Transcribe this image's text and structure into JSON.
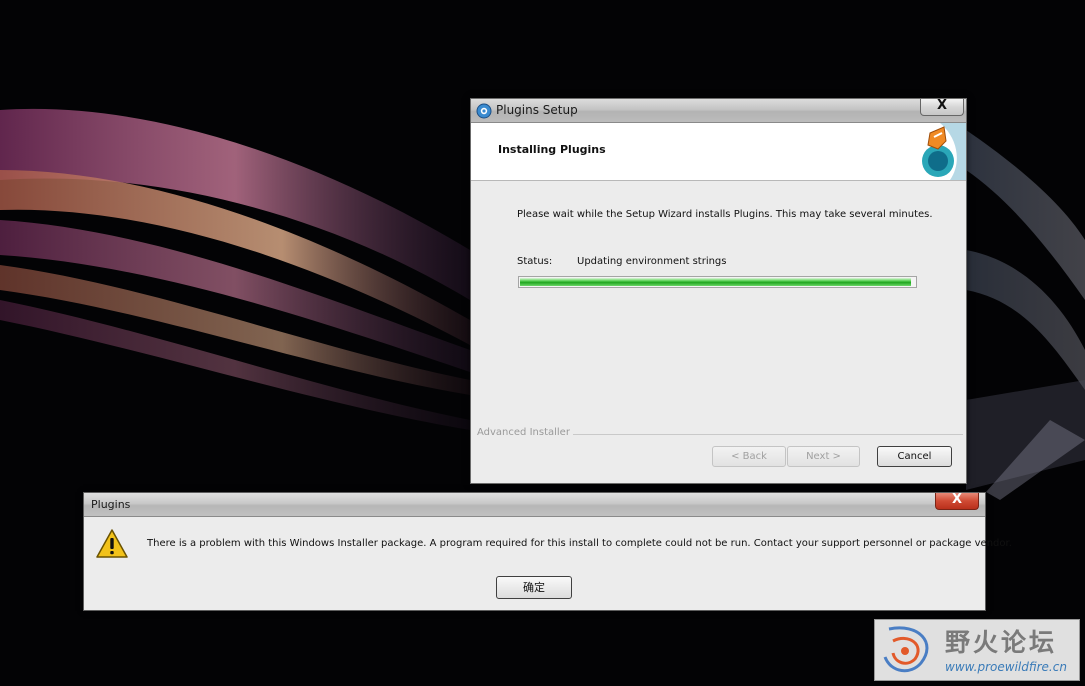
{
  "setup_window": {
    "title": "Plugins Setup",
    "close_label": "X",
    "banner_title": "Installing Plugins",
    "description": "Please wait while the Setup Wizard installs Plugins.  This may take several minutes.",
    "status_label": "Status:",
    "status_value": "Updating environment strings",
    "progress_fraction": 0.99,
    "branding": "Advanced Installer",
    "back_label": "< Back",
    "next_label": "Next >",
    "cancel_label": "Cancel"
  },
  "error_dialog": {
    "title": "Plugins",
    "close_label": "X",
    "message": "There is a problem with this Windows Installer package. A program required for this install to complete could not be run. Contact your support personnel or package vendor.",
    "ok_label": "确定"
  },
  "watermark": {
    "name": "野火论坛",
    "url": "www.proewildfire.cn"
  },
  "icons": [
    "app-icon",
    "wizard-logo-icon",
    "close-icon",
    "warning-icon",
    "forum-logo-icon"
  ],
  "colors": {
    "progress_green": "#1fa51f",
    "close_red": "#cf4a33",
    "warning_yellow": "#f2c21a"
  }
}
